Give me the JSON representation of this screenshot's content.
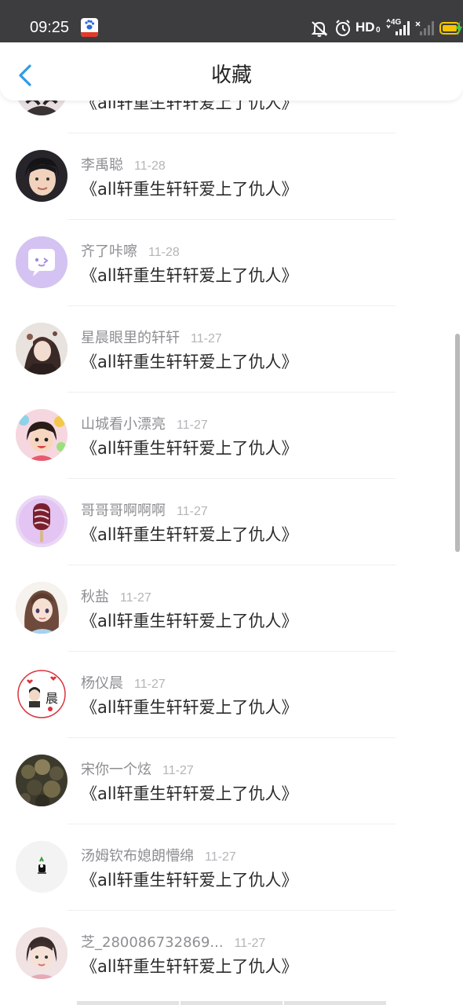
{
  "status_bar": {
    "time": "09:25",
    "network_label": "HD",
    "network_sub": "0",
    "signal_label": "4G",
    "battery_color": "#f5c400",
    "charging_color": "#34c759"
  },
  "header": {
    "title": "收藏",
    "accent_color": "#2f9ce6"
  },
  "items": [
    {
      "user": "",
      "date": "",
      "title": "《all轩重生轩轩爱上了仇人》"
    },
    {
      "user": "李禹聪",
      "date": "11-28",
      "title": "《all轩重生轩轩爱上了仇人》"
    },
    {
      "user": "齐了咔嚓",
      "date": "11-28",
      "title": "《all轩重生轩轩爱上了仇人》"
    },
    {
      "user": "星晨眼里的轩轩",
      "date": "11-27",
      "title": "《all轩重生轩轩爱上了仇人》"
    },
    {
      "user": "山城看小漂亮",
      "date": "11-27",
      "title": "《all轩重生轩轩爱上了仇人》"
    },
    {
      "user": "哥哥哥啊啊啊",
      "date": "11-27",
      "title": "《all轩重生轩轩爱上了仇人》"
    },
    {
      "user": "秋盐",
      "date": "11-27",
      "title": "《all轩重生轩轩爱上了仇人》"
    },
    {
      "user": "杨仪晨",
      "date": "11-27",
      "title": "《all轩重生轩轩爱上了仇人》"
    },
    {
      "user": "宋你一个炫",
      "date": "11-27",
      "title": "《all轩重生轩轩爱上了仇人》"
    },
    {
      "user": "汤姆钦布媳朗懵绵",
      "date": "11-27",
      "title": "《all轩重生轩轩爱上了仇人》"
    },
    {
      "user": "芝_280086732869...",
      "date": "11-27",
      "title": "《all轩重生轩轩爱上了仇人》"
    }
  ],
  "avatar_badge": "晨"
}
